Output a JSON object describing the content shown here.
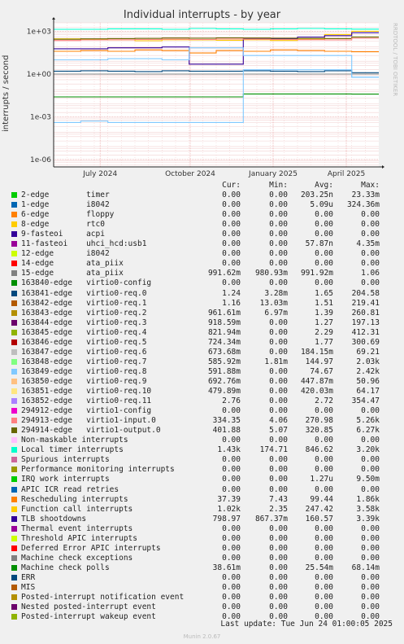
{
  "header": {
    "title": "Individual interrupts - by year",
    "side_text": "RRDTOOL / TOBI OETIKER",
    "ylabel": "interrupts / second"
  },
  "columns": {
    "cur": "Cur:",
    "min": "Min:",
    "avg": "Avg:",
    "max": "Max:"
  },
  "footer": {
    "last_update": "Last update: Tue Jun 24 01:00:05 2025",
    "munin": "Munin 2.0.67"
  },
  "chart_data": {
    "type": "line",
    "title": "Individual interrupts - by year",
    "ylabel": "interrupts / second",
    "yscale": "log",
    "ylim": [
      3e-07,
      4000
    ],
    "y_ticks": [
      {
        "v": 1000,
        "label": "1e+03"
      },
      {
        "v": 1,
        "label": "1e+00"
      },
      {
        "v": 0.001,
        "label": "1e-03"
      },
      {
        "v": 1e-06,
        "label": "1e-06"
      }
    ],
    "x_ticks": [
      "July 2024",
      "October 2024",
      "January 2025",
      "April 2025"
    ],
    "x_tick_pos": [
      0.143,
      0.42,
      0.675,
      0.9
    ],
    "legend": [
      {
        "name": "2-edge",
        "irq": "timer",
        "color": "#00cc00",
        "cur": "0.00",
        "min": "0.00",
        "avg": "203.25n",
        "max": "23.33m"
      },
      {
        "name": "1-edge",
        "irq": "i8042",
        "color": "#0066b3",
        "cur": "0.00",
        "min": "0.00",
        "avg": "5.09u",
        "max": "324.36m"
      },
      {
        "name": "6-edge",
        "irq": "floppy",
        "color": "#ff8000",
        "cur": "0.00",
        "min": "0.00",
        "avg": "0.00",
        "max": "0.00"
      },
      {
        "name": "8-edge",
        "irq": "rtc0",
        "color": "#ffcc00",
        "cur": "0.00",
        "min": "0.00",
        "avg": "0.00",
        "max": "0.00"
      },
      {
        "name": "9-fasteoi",
        "irq": "acpi",
        "color": "#330099",
        "cur": "0.00",
        "min": "0.00",
        "avg": "0.00",
        "max": "0.00"
      },
      {
        "name": "11-fasteoi",
        "irq": "uhci_hcd:usb1",
        "color": "#990099",
        "cur": "0.00",
        "min": "0.00",
        "avg": "57.87n",
        "max": "4.35m"
      },
      {
        "name": "12-edge",
        "irq": "i8042",
        "color": "#ccff00",
        "cur": "0.00",
        "min": "0.00",
        "avg": "0.00",
        "max": "0.00"
      },
      {
        "name": "14-edge",
        "irq": "ata_piix",
        "color": "#ff0000",
        "cur": "0.00",
        "min": "0.00",
        "avg": "0.00",
        "max": "0.00"
      },
      {
        "name": "15-edge",
        "irq": "ata_piix",
        "color": "#808080",
        "cur": "991.62m",
        "min": "980.93m",
        "avg": "991.92m",
        "max": "1.06"
      },
      {
        "name": "163840-edge",
        "irq": "virtio0-config",
        "color": "#008f00",
        "cur": "0.00",
        "min": "0.00",
        "avg": "0.00",
        "max": "0.00"
      },
      {
        "name": "163841-edge",
        "irq": "virtio0-req.0",
        "color": "#00487d",
        "cur": "1.24",
        "min": "3.28m",
        "avg": "1.65",
        "max": "204.58"
      },
      {
        "name": "163842-edge",
        "irq": "virtio0-req.1",
        "color": "#b35a00",
        "cur": "1.16",
        "min": "13.03m",
        "avg": "1.51",
        "max": "219.41"
      },
      {
        "name": "163843-edge",
        "irq": "virtio0-req.2",
        "color": "#b38f00",
        "cur": "961.61m",
        "min": "6.97m",
        "avg": "1.39",
        "max": "260.81"
      },
      {
        "name": "163844-edge",
        "irq": "virtio0-req.3",
        "color": "#6b006b",
        "cur": "918.59m",
        "min": "0.00",
        "avg": "1.27",
        "max": "197.13"
      },
      {
        "name": "163845-edge",
        "irq": "virtio0-req.4",
        "color": "#8fb300",
        "cur": "821.94m",
        "min": "0.00",
        "avg": "2.29",
        "max": "412.31"
      },
      {
        "name": "163846-edge",
        "irq": "virtio0-req.5",
        "color": "#b30000",
        "cur": "724.34m",
        "min": "0.00",
        "avg": "1.77",
        "max": "300.69"
      },
      {
        "name": "163847-edge",
        "irq": "virtio0-req.6",
        "color": "#bebebe",
        "cur": "673.68m",
        "min": "0.00",
        "avg": "184.15m",
        "max": "69.21"
      },
      {
        "name": "163848-edge",
        "irq": "virtio0-req.7",
        "color": "#80ff80",
        "cur": "585.92m",
        "min": "1.81m",
        "avg": "144.97",
        "max": "2.03k"
      },
      {
        "name": "163849-edge",
        "irq": "virtio0-req.8",
        "color": "#80c9ff",
        "cur": "591.88m",
        "min": "0.00",
        "avg": "74.67",
        "max": "2.42k"
      },
      {
        "name": "163850-edge",
        "irq": "virtio0-req.9",
        "color": "#ffc080",
        "cur": "692.76m",
        "min": "0.00",
        "avg": "447.87m",
        "max": "50.96"
      },
      {
        "name": "163851-edge",
        "irq": "virtio0-req.10",
        "color": "#ffe680",
        "cur": "479.89m",
        "min": "0.00",
        "avg": "420.03m",
        "max": "64.17"
      },
      {
        "name": "163852-edge",
        "irq": "virtio0-req.11",
        "color": "#aa80ff",
        "cur": "2.76",
        "min": "0.00",
        "avg": "2.72",
        "max": "354.47"
      },
      {
        "name": "294912-edge",
        "irq": "virtio1-config",
        "color": "#ee00cc",
        "cur": "0.00",
        "min": "0.00",
        "avg": "0.00",
        "max": "0.00"
      },
      {
        "name": "294913-edge",
        "irq": "virtio1-input.0",
        "color": "#ff8080",
        "cur": "334.35",
        "min": "4.06",
        "avg": "270.98",
        "max": "5.26k"
      },
      {
        "name": "294914-edge",
        "irq": "virtio1-output.0",
        "color": "#666600",
        "cur": "401.88",
        "min": "5.07",
        "avg": "320.85",
        "max": "6.27k"
      },
      {
        "name": "Non-maskable interrupts",
        "irq": "",
        "color": "#ffbfff",
        "cur": "0.00",
        "min": "0.00",
        "avg": "0.00",
        "max": "0.00"
      },
      {
        "name": "Local timer interrupts",
        "irq": "",
        "color": "#00ffcc",
        "cur": "1.43k",
        "min": "174.71",
        "avg": "846.62",
        "max": "3.20k"
      },
      {
        "name": "Spurious interrupts",
        "irq": "",
        "color": "#cc6699",
        "cur": "0.00",
        "min": "0.00",
        "avg": "0.00",
        "max": "0.00"
      },
      {
        "name": "Performance monitoring interrupts",
        "irq": "",
        "color": "#999900",
        "cur": "0.00",
        "min": "0.00",
        "avg": "0.00",
        "max": "0.00"
      },
      {
        "name": "IRQ work interrupts",
        "irq": "",
        "color": "#00cc00",
        "cur": "0.00",
        "min": "0.00",
        "avg": "1.27u",
        "max": "9.50m"
      },
      {
        "name": "APIC ICR read retries",
        "irq": "",
        "color": "#0066b3",
        "cur": "0.00",
        "min": "0.00",
        "avg": "0.00",
        "max": "0.00"
      },
      {
        "name": "Rescheduling interrupts",
        "irq": "",
        "color": "#ff8000",
        "cur": "37.39",
        "min": "7.43",
        "avg": "99.44",
        "max": "1.86k"
      },
      {
        "name": "Function call interrupts",
        "irq": "",
        "color": "#ffcc00",
        "cur": "1.02k",
        "min": "2.35",
        "avg": "247.42",
        "max": "3.58k"
      },
      {
        "name": "TLB shootdowns",
        "irq": "",
        "color": "#330099",
        "cur": "798.97",
        "min": "867.37m",
        "avg": "160.57",
        "max": "3.39k"
      },
      {
        "name": "Thermal event interrupts",
        "irq": "",
        "color": "#990099",
        "cur": "0.00",
        "min": "0.00",
        "avg": "0.00",
        "max": "0.00"
      },
      {
        "name": "Threshold APIC interrupts",
        "irq": "",
        "color": "#ccff00",
        "cur": "0.00",
        "min": "0.00",
        "avg": "0.00",
        "max": "0.00"
      },
      {
        "name": "Deferred Error APIC interrupts",
        "irq": "",
        "color": "#ff0000",
        "cur": "0.00",
        "min": "0.00",
        "avg": "0.00",
        "max": "0.00"
      },
      {
        "name": "Machine check exceptions",
        "irq": "",
        "color": "#808080",
        "cur": "0.00",
        "min": "0.00",
        "avg": "0.00",
        "max": "0.00"
      },
      {
        "name": "Machine check polls",
        "irq": "",
        "color": "#008f00",
        "cur": "38.61m",
        "min": "0.00",
        "avg": "25.54m",
        "max": "68.14m"
      },
      {
        "name": "ERR",
        "irq": "",
        "color": "#00487d",
        "cur": "0.00",
        "min": "0.00",
        "avg": "0.00",
        "max": "0.00"
      },
      {
        "name": "MIS",
        "irq": "",
        "color": "#b35a00",
        "cur": "0.00",
        "min": "0.00",
        "avg": "0.00",
        "max": "0.00"
      },
      {
        "name": "Posted-interrupt notification event",
        "irq": "",
        "color": "#b38f00",
        "cur": "0.00",
        "min": "0.00",
        "avg": "0.00",
        "max": "0.00"
      },
      {
        "name": "Nested posted-interrupt event",
        "irq": "",
        "color": "#6b006b",
        "cur": "0.00",
        "min": "0.00",
        "avg": "0.00",
        "max": "0.00"
      },
      {
        "name": "Posted-interrupt wakeup event",
        "irq": "",
        "color": "#8fb300",
        "cur": "0.00",
        "min": "0.00",
        "avg": "0.00",
        "max": "0.00"
      }
    ],
    "series_levels": [
      {
        "legend": "Local timer interrupts",
        "values": [
          1400,
          1400,
          1500,
          1500,
          1400,
          1600,
          1500,
          1400,
          1500,
          1600,
          1500,
          1430
        ]
      },
      {
        "legend": "Function call interrupts",
        "values": [
          300,
          280,
          250,
          220,
          260,
          250,
          240,
          260,
          230,
          280,
          600,
          1020
        ]
      },
      {
        "legend": "TLB shootdowns",
        "values": [
          60,
          60,
          70,
          70,
          80,
          5,
          5,
          300,
          300,
          400,
          500,
          799
        ]
      },
      {
        "legend": "294914-edge",
        "values": [
          280,
          300,
          310,
          320,
          340,
          330,
          350,
          340,
          330,
          320,
          310,
          402
        ]
      },
      {
        "legend": "294913-edge",
        "values": [
          230,
          250,
          260,
          270,
          280,
          270,
          290,
          280,
          270,
          260,
          250,
          334
        ]
      },
      {
        "legend": "Rescheduling interrupts",
        "values": [
          40,
          45,
          40,
          50,
          45,
          30,
          45,
          40,
          50,
          45,
          40,
          37
        ]
      },
      {
        "legend": "163849-edge",
        "values": [
          10,
          10,
          12,
          12,
          10,
          70,
          70,
          20,
          20,
          20,
          20,
          0.6
        ]
      },
      {
        "legend": "163841-edge",
        "values": [
          1.6,
          1.7,
          1.6,
          1.5,
          1.7,
          1.6,
          1.6,
          1.7,
          1.6,
          1.5,
          1.7,
          1.24
        ]
      },
      {
        "legend": "15-edge",
        "values": [
          0.99,
          0.99,
          0.99,
          0.99,
          0.99,
          0.99,
          0.99,
          0.99,
          0.99,
          0.99,
          0.99,
          0.99
        ]
      },
      {
        "legend": "Machine check polls",
        "values": [
          0.025,
          0.025,
          0.025,
          0.025,
          0.025,
          0.025,
          0.025,
          0.04,
          0.04,
          0.04,
          0.04,
          0.039
        ]
      },
      {
        "legend": "163849-edge",
        "values": [
          0.0004,
          0.0005,
          0.0004,
          0.0004,
          0.0004,
          0.0004,
          0.0004,
          2,
          2,
          2,
          2,
          0.6
        ]
      }
    ]
  }
}
